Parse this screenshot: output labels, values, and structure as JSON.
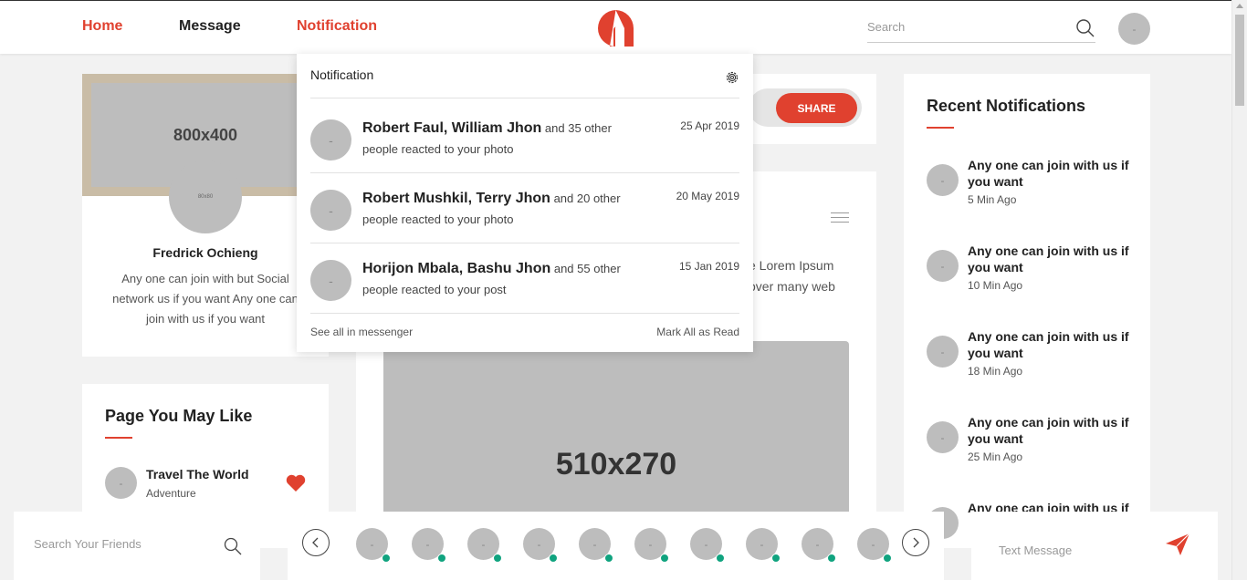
{
  "header": {
    "nav": [
      {
        "label": "Home"
      },
      {
        "label": "Message"
      },
      {
        "label": "Notification"
      }
    ],
    "search_placeholder": "Search",
    "avatar_glyph": "-"
  },
  "profile": {
    "cover_label": "800x400",
    "avatar_label": "80x80",
    "name": "Fredrick Ochieng",
    "bio": "Any one can join with but Social network us if you want Any one can join with us if you want"
  },
  "pages_you_may_like": {
    "title": "Page You May Like",
    "items": [
      {
        "name": "Travel The World",
        "category": "Adventure",
        "avatar_glyph": "-"
      }
    ]
  },
  "share": {
    "button_label": "SHARE"
  },
  "post": {
    "text_line1": "e Lorem Ipsum",
    "text_line2": "over many web",
    "image_label": "510x270"
  },
  "recent_notifications": {
    "title": "Recent Notifications",
    "items": [
      {
        "text": "Any one can join with us if you want",
        "time": "5 Min Ago",
        "avatar_glyph": "-"
      },
      {
        "text": "Any one can join with us if you want",
        "time": "10 Min Ago",
        "avatar_glyph": "-"
      },
      {
        "text": "Any one can join with us if you want",
        "time": "18 Min Ago",
        "avatar_glyph": "-"
      },
      {
        "text": "Any one can join with us if you want",
        "time": "25 Min Ago",
        "avatar_glyph": "-"
      },
      {
        "text": "Any one can join with us if",
        "time": "",
        "avatar_glyph": "-"
      }
    ]
  },
  "notification_dropdown": {
    "title": "Notification",
    "items": [
      {
        "name1": "Robert Faul",
        "name2": "William Jhon",
        "rest": " and 35 other people reacted to your photo",
        "date": "25 Apr 2019",
        "avatar_glyph": "-"
      },
      {
        "name1": "Robert Mushkil",
        "name2": "Terry Jhon",
        "rest": " and 20 other people reacted to your photo",
        "date": "20 May 2019",
        "avatar_glyph": "-"
      },
      {
        "name1": "Horijon Mbala",
        "name2": "Bashu Jhon",
        "rest": " and 55 other people reacted to your post",
        "date": "15 Jan 2019",
        "avatar_glyph": "-"
      }
    ],
    "see_all": "See all in messenger",
    "mark_all": "Mark All as Read"
  },
  "bottom_bar": {
    "friend_search_placeholder": "Search Your Friends",
    "friends": [
      {
        "glyph": "-",
        "online": true
      },
      {
        "glyph": "-",
        "online": true
      },
      {
        "glyph": "-",
        "online": true
      },
      {
        "glyph": "-",
        "online": true
      },
      {
        "glyph": "-",
        "online": true
      },
      {
        "glyph": "-",
        "online": true
      },
      {
        "glyph": "-",
        "online": true
      },
      {
        "glyph": "-",
        "online": true
      },
      {
        "glyph": "-",
        "online": true
      },
      {
        "glyph": "-",
        "online": true
      }
    ],
    "message_placeholder": "Text Message"
  },
  "colors": {
    "accent": "#e0412f",
    "online": "#10a37f",
    "placeholder_gray": "#bdbdbd"
  }
}
